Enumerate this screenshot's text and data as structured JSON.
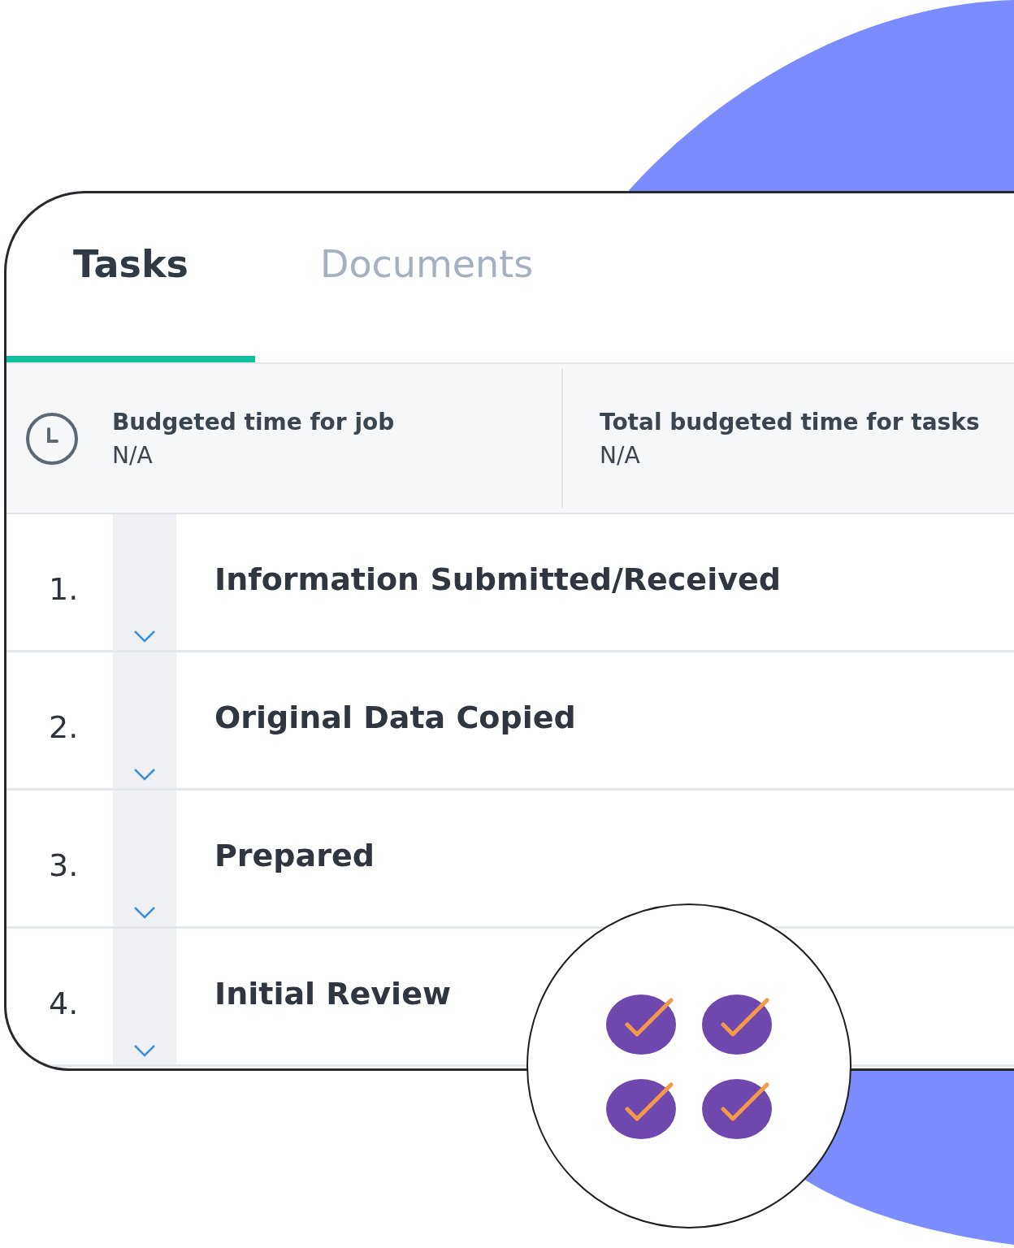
{
  "tabs": [
    {
      "label": "Tasks",
      "selected": true
    },
    {
      "label": "Documents",
      "selected": false
    }
  ],
  "budget": [
    {
      "label": "Budgeted time for job",
      "value": "N/A"
    },
    {
      "label": "Total budgeted time for tasks",
      "value": "N/A"
    }
  ],
  "tasks": [
    {
      "number": "1.",
      "title": "Information Submitted/Received"
    },
    {
      "number": "2.",
      "title": "Original Data Copied"
    },
    {
      "number": "3.",
      "title": "Prepared"
    },
    {
      "number": "4.",
      "title": "Initial Review"
    }
  ]
}
